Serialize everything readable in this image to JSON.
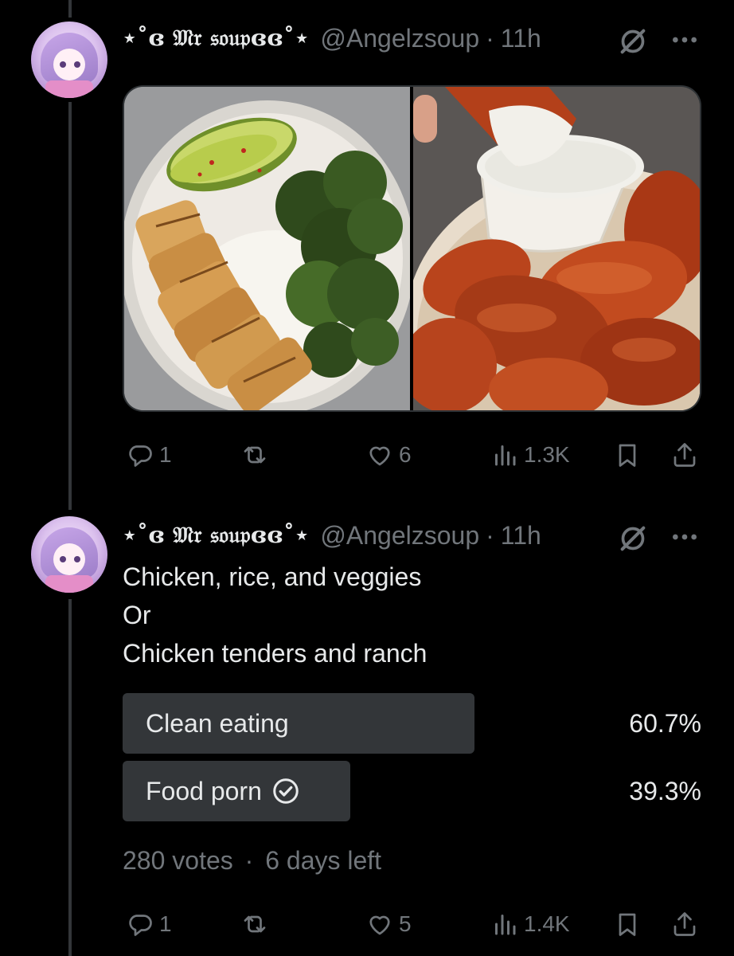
{
  "tweets": [
    {
      "display_name": "⋆˚ɞ 𝔐𝔯 𝔰𝔬𝔲𝔭ɞɞ˚⋆",
      "handle": "@Angelzsoup",
      "separator": "·",
      "time": "11h",
      "media": [
        "chicken-rice-veggie-bowl",
        "chicken-tenders-with-ranch"
      ],
      "actions": {
        "replies": "1",
        "reposts": "",
        "likes": "6",
        "views": "1.3K"
      }
    },
    {
      "display_name": "⋆˚ɞ 𝔐𝔯 𝔰𝔬𝔲𝔭ɞɞ˚⋆",
      "handle": "@Angelzsoup",
      "separator": "·",
      "time": "11h",
      "text_lines": [
        "Chicken, rice, and veggies",
        "Or",
        "Chicken tenders and ranch"
      ],
      "poll": {
        "options": [
          {
            "label": "Clean eating",
            "percent_text": "60.7%",
            "percent": 60.7,
            "voted": false
          },
          {
            "label": "Food porn",
            "percent_text": "39.3%",
            "percent": 39.3,
            "voted": true
          }
        ],
        "votes": "280 votes",
        "separator": "·",
        "time_left": "6 days left"
      },
      "actions": {
        "replies": "1",
        "reposts": "",
        "likes": "5",
        "views": "1.4K"
      }
    }
  ],
  "icons": {
    "reply": "reply-icon",
    "repost": "repost-icon",
    "like": "heart-icon",
    "views": "analytics-icon",
    "bookmark": "bookmark-icon",
    "share": "share-icon",
    "grok": "grok-icon",
    "more": "more-icon",
    "voted": "check-circle-icon"
  },
  "colors": {
    "background": "#000000",
    "text": "#e7e9ea",
    "secondary": "#71767b",
    "poll_bar": "#333639",
    "thread_line": "#333639"
  }
}
